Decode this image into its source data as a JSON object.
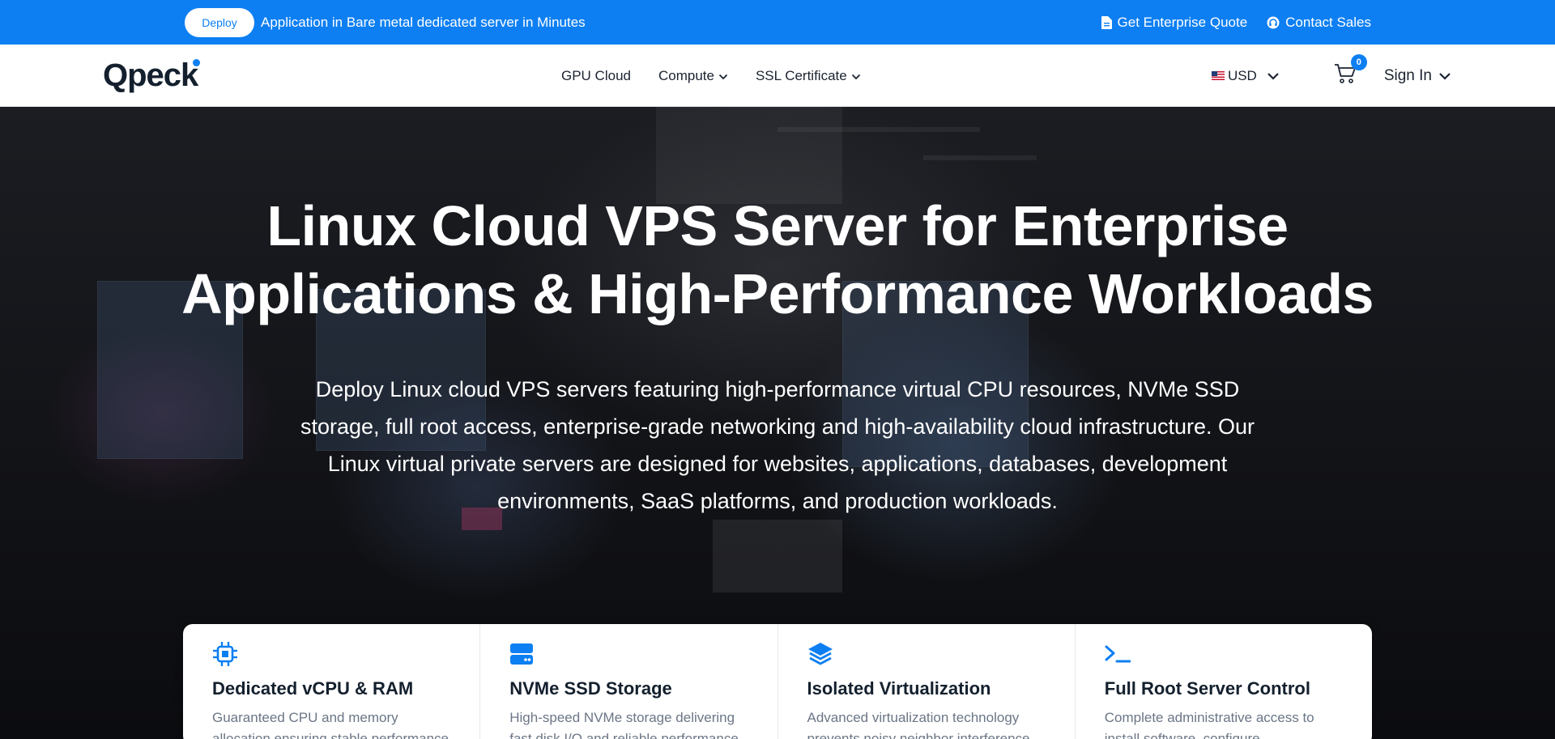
{
  "topbar": {
    "deploy_label": "Deploy",
    "announcement": "Application in Bare metal dedicated server in Minutes",
    "enterprise_quote": "Get Enterprise Quote",
    "contact_sales": "Contact Sales",
    "background_color": "#0d7ff2"
  },
  "nav": {
    "logo": "Qpeck",
    "menu": [
      {
        "label": "GPU Cloud",
        "has_dropdown": false
      },
      {
        "label": "Compute",
        "has_dropdown": true
      },
      {
        "label": "SSL Certificate",
        "has_dropdown": true
      }
    ],
    "currency": "USD",
    "cart_count": "0",
    "sign_in": "Sign In"
  },
  "hero": {
    "title_line1": "Linux Cloud VPS Server for Enterprise",
    "title_line2": "Applications & High-Performance Workloads",
    "subtitle": "Deploy Linux cloud VPS servers featuring high-performance virtual CPU resources, NVMe SSD storage, full root access, enterprise-grade networking and high-availability cloud infrastructure. Our Linux virtual private servers are designed for websites, applications, databases, development environments, SaaS platforms, and production workloads."
  },
  "features": [
    {
      "icon": "cpu-icon",
      "title": "Dedicated vCPU & RAM",
      "desc": "Guaranteed CPU and memory allocation ensuring stable performance"
    },
    {
      "icon": "storage-icon",
      "title": "NVMe SSD Storage",
      "desc": "High-speed NVMe storage delivering fast disk I/O and reliable performance"
    },
    {
      "icon": "layers-icon",
      "title": "Isolated Virtualization",
      "desc": "Advanced virtualization technology prevents noisy neighbor interference"
    },
    {
      "icon": "terminal-icon",
      "title": "Full Root Server Control",
      "desc": "Complete administrative access to install software, configure"
    }
  ],
  "colors": {
    "accent": "#0d7ff2",
    "text_dark": "#14202e",
    "text_muted": "#6b7686"
  }
}
